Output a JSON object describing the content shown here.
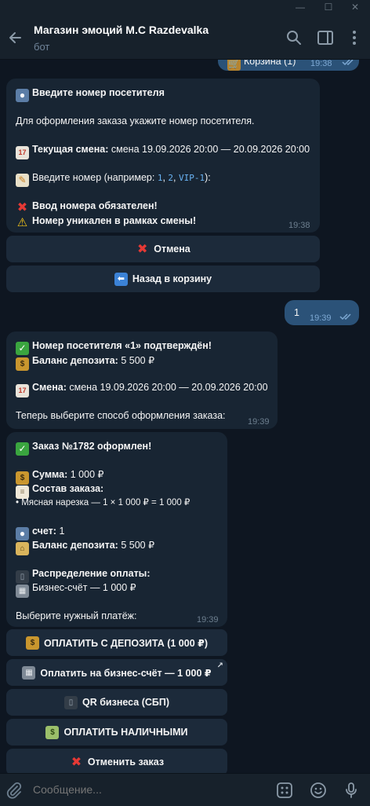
{
  "header": {
    "title": "Магазин эмоций M.C Razdevalka",
    "subtitle": "бот"
  },
  "prev_message": {
    "text": "Корзина (1)",
    "time": "19:38"
  },
  "msg1": {
    "title": "Введите номер посетителя",
    "intro": "Для оформления заказа укажите номер посетителя.",
    "shift_label": "Текущая смена:",
    "shift_value": "смена 19.09.2026 20:00 — 20.09.2026 20:00",
    "enter_prefix": "Введите номер (например:",
    "example1": "1",
    "sep1": ",",
    "example2": "2",
    "sep2": ",",
    "example3": "VIP-1",
    "enter_suffix": "):",
    "warning1": "Ввод номера обязателен!",
    "warning2": "Номер уникален в рамках смены!",
    "time": "19:38"
  },
  "keyboard1": {
    "cancel": "Отмена",
    "back_to_cart": "Назад в корзину"
  },
  "user_msg": {
    "text": "1",
    "time": "19:39"
  },
  "msg2": {
    "confirmed": "Номер посетителя «1» подтверждён!",
    "balance_label": "Баланс депозита:",
    "balance_value": "5 500 ₽",
    "shift_label": "Смена:",
    "shift_value": "смена 19.09.2026 20:00 — 20.09.2026 20:00",
    "choose": "Теперь выберите способ оформления заказа:",
    "time": "19:39"
  },
  "msg3": {
    "order_title": "Заказ №1782 оформлен!",
    "sum_label": "Сумма:",
    "sum_value": "1 000 ₽",
    "composition_label": "Состав заказа:",
    "item": "• Мясная нарезка — 1 × 1 000 ₽ = 1 000 ₽",
    "account_label": "счет:",
    "account_value": "1",
    "balance_label": "Баланс депозита:",
    "balance_value": "5 500 ₽",
    "distribution_label": "Распределение оплаты:",
    "distribution_value": "Бизнес-счёт — 1 000 ₽",
    "choose_payment": "Выберите нужный платёж:",
    "time": "19:39"
  },
  "keyboard2": {
    "pay_deposit": "ОПЛАТИТЬ С ДЕПОЗИТА (1 000 ₽)",
    "pay_business": "Оплатить на бизнес-счёт — 1 000 ₽",
    "qr_business": "QR бизнеса (СБП)",
    "pay_cash": "ОПЛАТИТЬ НАЛИЧНЫМИ",
    "cancel_order": "Отменить заказ"
  },
  "composer": {
    "placeholder": "Сообщение..."
  },
  "colors": {
    "background": "#0e1621",
    "incoming_bubble": "#182533",
    "outgoing_bubble": "#2b5278",
    "panel": "#17212b",
    "link": "#6ab3f3"
  }
}
